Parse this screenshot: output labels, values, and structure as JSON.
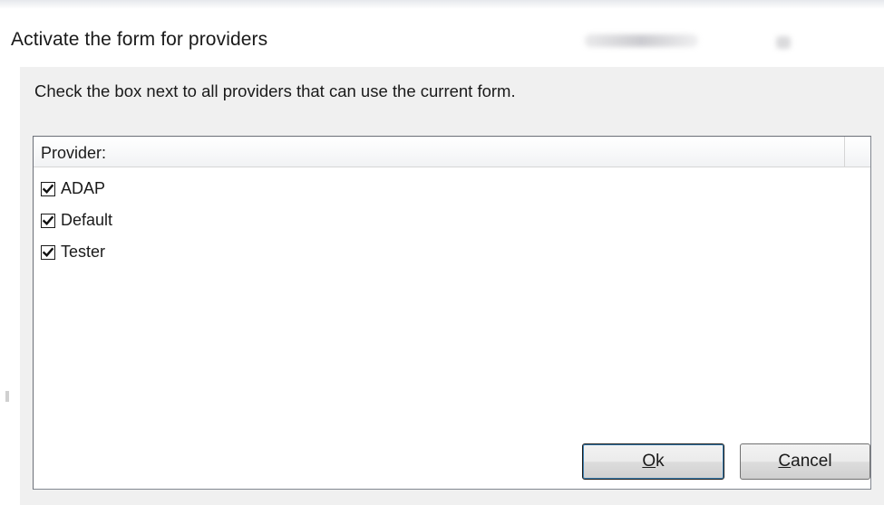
{
  "window": {
    "title": "Activate the form for providers"
  },
  "dialog": {
    "instruction": "Check the box next to all providers that can use the current form."
  },
  "provider_list": {
    "column_header": "Provider:",
    "items": [
      {
        "label": "ADAP",
        "checked": true
      },
      {
        "label": "Default",
        "checked": true
      },
      {
        "label": "Tester",
        "checked": true
      }
    ]
  },
  "buttons": {
    "ok_mnemonic": "O",
    "ok_rest": "k",
    "cancel_mnemonic": "C",
    "cancel_rest": "ancel"
  }
}
